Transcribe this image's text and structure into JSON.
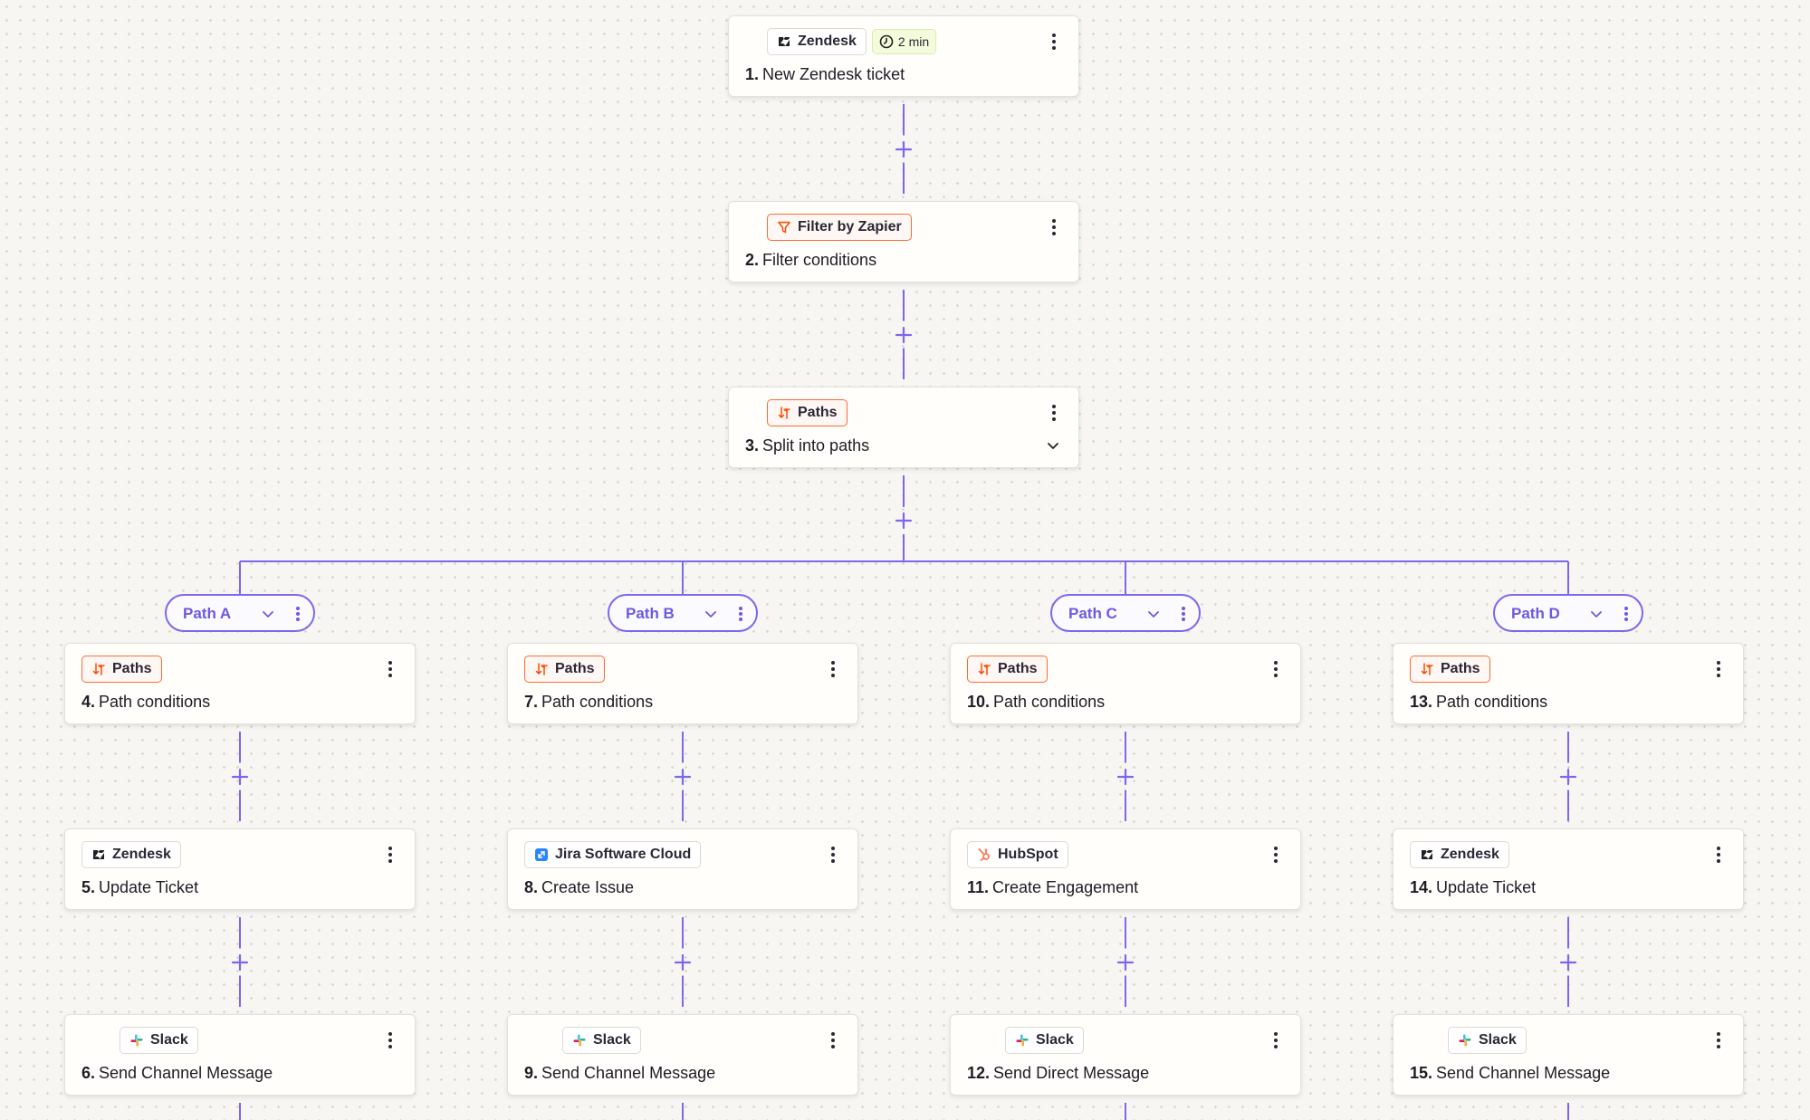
{
  "colors": {
    "connector": "#7b68ee",
    "paths_accent": "#ff6a35",
    "path_label": "#6b5ae0",
    "time_badge_bg": "#f4fbdd"
  },
  "top_steps": [
    {
      "app": "Zendesk",
      "app_icon": "zendesk-icon",
      "time": "2 min",
      "number": "1.",
      "title": "New Zendesk ticket"
    },
    {
      "app": "Filter by Zapier",
      "app_icon": "filter-icon",
      "number": "2.",
      "title": "Filter conditions"
    },
    {
      "app": "Paths",
      "app_icon": "paths-icon",
      "number": "3.",
      "title": "Split into paths"
    }
  ],
  "paths": [
    {
      "label": "Path A",
      "steps": [
        {
          "app": "Paths",
          "app_icon": "paths-icon",
          "number": "4.",
          "title": "Path conditions"
        },
        {
          "app": "Zendesk",
          "app_icon": "zendesk-icon",
          "number": "5.",
          "title": "Update Ticket"
        },
        {
          "app": "Slack",
          "app_icon": "slack-icon",
          "number": "6.",
          "title": "Send Channel Message"
        }
      ]
    },
    {
      "label": "Path B",
      "steps": [
        {
          "app": "Paths",
          "app_icon": "paths-icon",
          "number": "7.",
          "title": "Path conditions"
        },
        {
          "app": "Jira Software Cloud",
          "app_icon": "jira-icon",
          "number": "8.",
          "title": "Create Issue"
        },
        {
          "app": "Slack",
          "app_icon": "slack-icon",
          "number": "9.",
          "title": "Send Channel Message"
        }
      ]
    },
    {
      "label": "Path C",
      "steps": [
        {
          "app": "Paths",
          "app_icon": "paths-icon",
          "number": "10.",
          "title": "Path conditions"
        },
        {
          "app": "HubSpot",
          "app_icon": "hubspot-icon",
          "number": "11.",
          "title": "Create Engagement"
        },
        {
          "app": "Slack",
          "app_icon": "slack-icon",
          "number": "12.",
          "title": "Send Direct Message"
        }
      ]
    },
    {
      "label": "Path D",
      "steps": [
        {
          "app": "Paths",
          "app_icon": "paths-icon",
          "number": "13.",
          "title": "Path conditions"
        },
        {
          "app": "Zendesk",
          "app_icon": "zendesk-icon",
          "number": "14.",
          "title": "Update Ticket"
        },
        {
          "app": "Slack",
          "app_icon": "slack-icon",
          "number": "15.",
          "title": "Send Channel Message"
        }
      ]
    }
  ]
}
